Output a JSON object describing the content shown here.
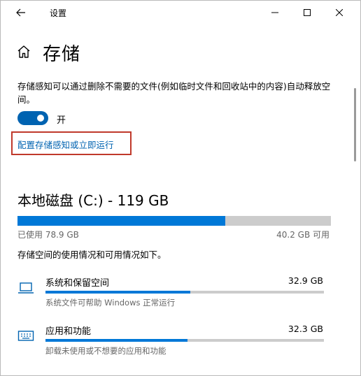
{
  "window": {
    "title": "设置"
  },
  "header": {
    "page_title": "存储"
  },
  "storage_sense": {
    "description": "存储感知可以通过删除不需要的文件(例如临时文件和回收站中的内容)自动释放空间。",
    "toggle_state": "开",
    "toggle_on": true,
    "config_link": "配置存储感知或立即运行"
  },
  "disk": {
    "title": "本地磁盘 (C:) - 119 GB",
    "used_label": "已使用 78.9 GB",
    "free_label": "40.2 GB 可用",
    "used_fraction": 0.663
  },
  "usage_description": "存储空间的使用情况和可用情况如下。",
  "categories": [
    {
      "name": "系统和保留空间",
      "size": "32.9 GB",
      "subtitle": "系统文件可帮助 Windows 正常运行",
      "fraction": 0.52,
      "icon": "laptop-icon"
    },
    {
      "name": "应用和功能",
      "size": "32.3 GB",
      "subtitle": "卸载未使用或不想要的应用和功能",
      "fraction": 0.51,
      "icon": "keyboard-icon"
    }
  ],
  "colors": {
    "accent": "#0078d7",
    "toggle": "#0063b1",
    "link": "#0063b1",
    "highlight_box": "#c0392b"
  }
}
